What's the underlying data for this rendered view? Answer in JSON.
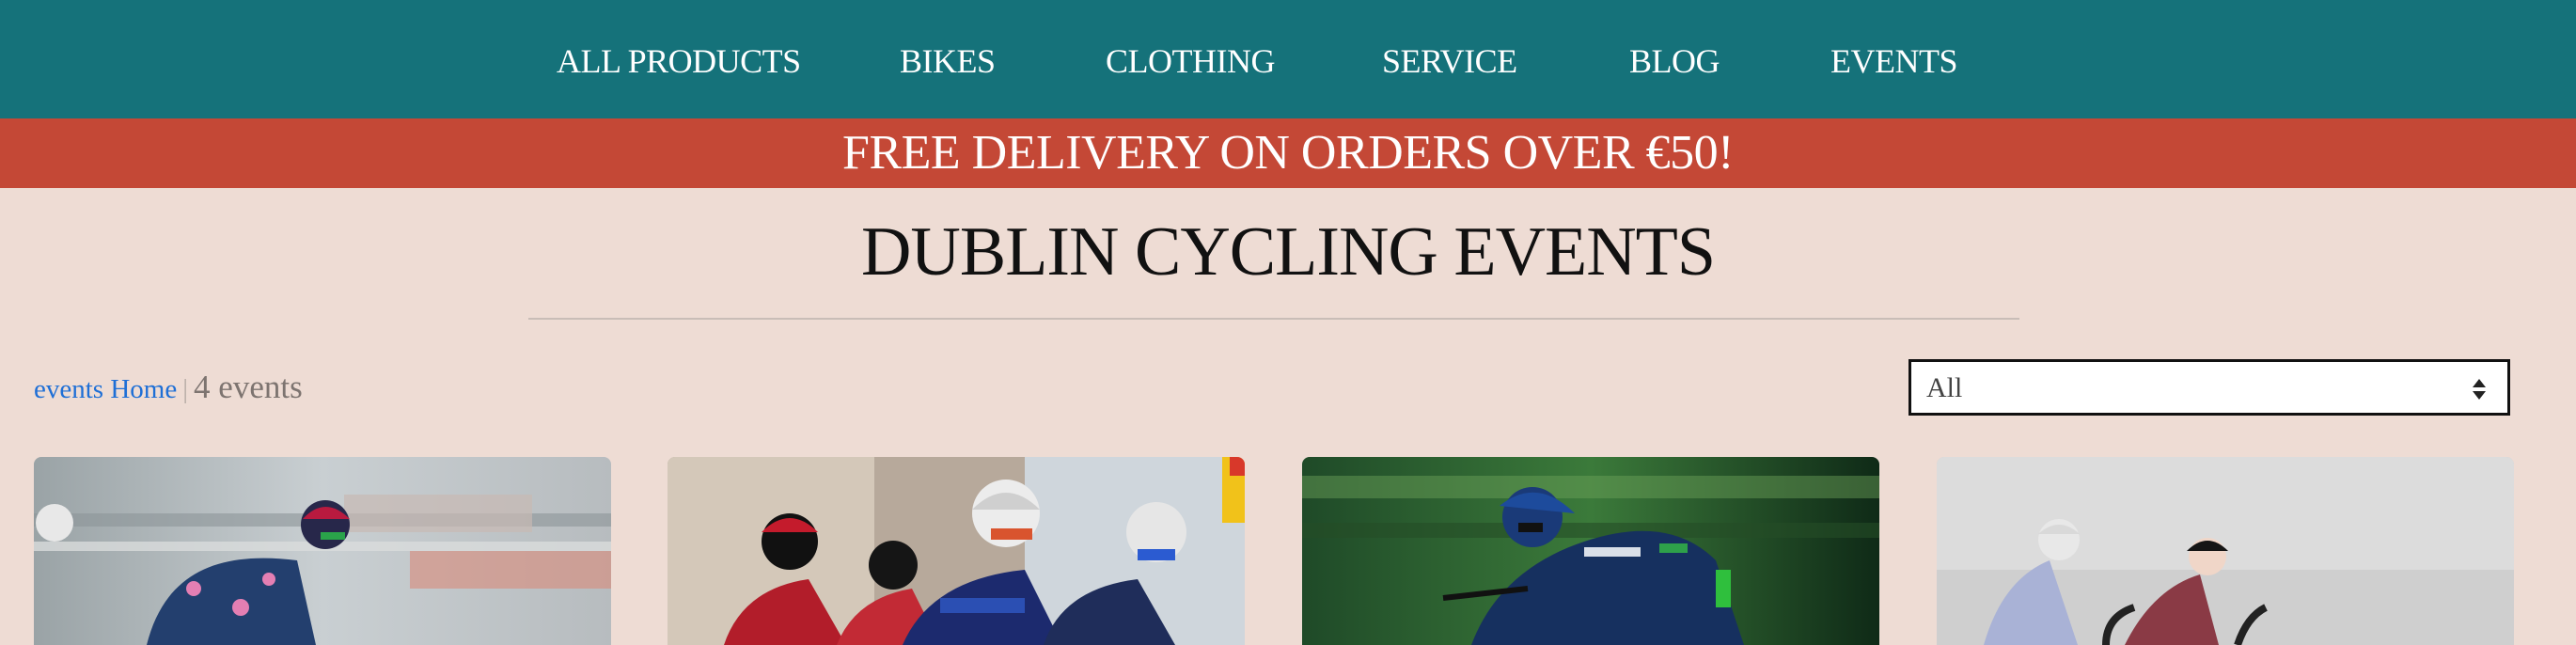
{
  "nav": {
    "items": [
      {
        "label": "ALL PRODUCTS"
      },
      {
        "label": "BIKES"
      },
      {
        "label": "CLOTHING"
      },
      {
        "label": "SERVICE"
      },
      {
        "label": "BLOG"
      },
      {
        "label": "EVENTS"
      }
    ]
  },
  "promo": {
    "text": "FREE DELIVERY ON ORDERS OVER €50!"
  },
  "page": {
    "title": "DUBLIN CYCLING EVENTS"
  },
  "breadcrumb": {
    "home_link": "events Home",
    "separator": "|",
    "count": "4 events"
  },
  "filter": {
    "selected": "All"
  },
  "colors": {
    "nav_bg": "#15727a",
    "promo_bg": "#c44836",
    "page_bg": "#eedcd4",
    "link": "#1e6fd6"
  }
}
